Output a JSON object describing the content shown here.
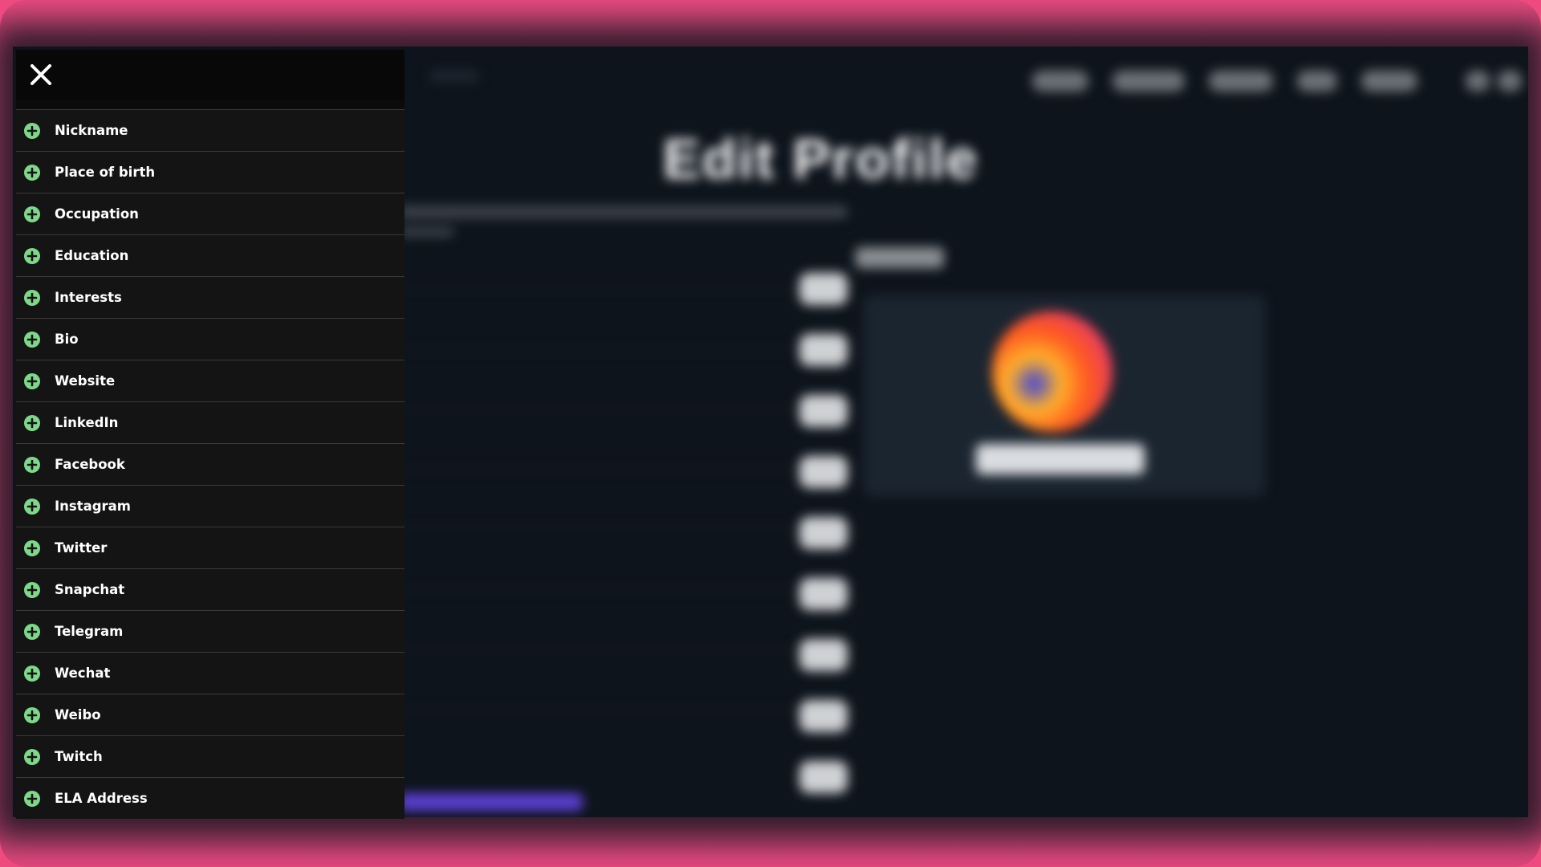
{
  "background": {
    "title": "Edit Profile"
  },
  "drawer": {
    "close_icon": "close-icon",
    "add_icon": "plus-circle-icon",
    "accent_color": "#7ed88a",
    "items": [
      {
        "label": "Nickname"
      },
      {
        "label": "Place of birth"
      },
      {
        "label": "Occupation"
      },
      {
        "label": "Education"
      },
      {
        "label": "Interests"
      },
      {
        "label": "Bio"
      },
      {
        "label": "Website"
      },
      {
        "label": "LinkedIn"
      },
      {
        "label": "Facebook"
      },
      {
        "label": "Instagram"
      },
      {
        "label": "Twitter"
      },
      {
        "label": "Snapchat"
      },
      {
        "label": "Telegram"
      },
      {
        "label": "Wechat"
      },
      {
        "label": "Weibo"
      },
      {
        "label": "Twitch"
      },
      {
        "label": "ELA Address"
      }
    ]
  }
}
